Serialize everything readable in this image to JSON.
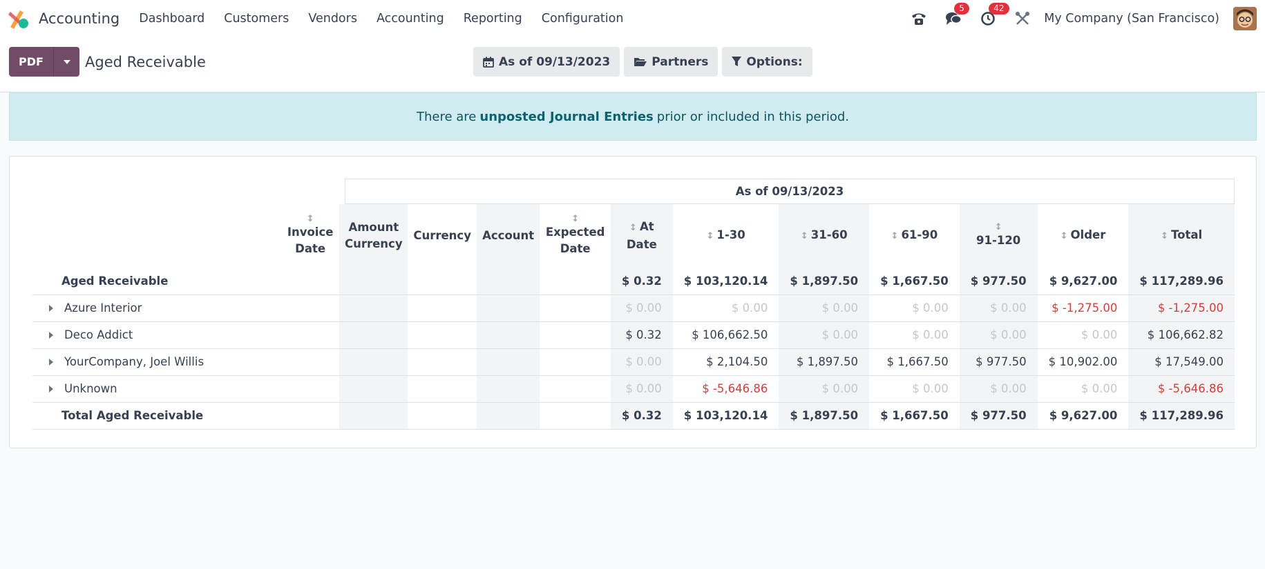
{
  "nav": {
    "app_name": "Accounting",
    "menu": [
      "Dashboard",
      "Customers",
      "Vendors",
      "Accounting",
      "Reporting",
      "Configuration"
    ],
    "messages_count": "5",
    "activities_count": "42",
    "company": "My Company (San Francisco)"
  },
  "control": {
    "pdf_label": "PDF",
    "title": "Aged Receivable",
    "date_filter": "As of 09/13/2023",
    "partners_filter": "Partners",
    "options_filter": "Options:"
  },
  "alert": {
    "prefix": "There are",
    "link": "unposted Journal Entries",
    "suffix": "prior or included in this period."
  },
  "report": {
    "period": "As of 09/13/2023",
    "columns": [
      "Invoice Date",
      "Amount Currency",
      "Currency",
      "Account",
      "Expected Date",
      "At Date",
      "1-30",
      "31-60",
      "61-90",
      "91-120",
      "Older",
      "Total"
    ],
    "group_label": "Aged Receivable",
    "group_values": [
      "$ 0.32",
      "$ 103,120.14",
      "$ 1,897.50",
      "$ 1,667.50",
      "$ 977.50",
      "$ 9,627.00",
      "$ 117,289.96"
    ],
    "rows": [
      {
        "name": "Azure Interior",
        "values": [
          "$ 0.00",
          "$ 0.00",
          "$ 0.00",
          "$ 0.00",
          "$ 0.00",
          "$ -1,275.00",
          "$ -1,275.00"
        ]
      },
      {
        "name": "Deco Addict",
        "values": [
          "$ 0.32",
          "$ 106,662.50",
          "$ 0.00",
          "$ 0.00",
          "$ 0.00",
          "$ 0.00",
          "$ 106,662.82"
        ]
      },
      {
        "name": "YourCompany, Joel Willis",
        "values": [
          "$ 0.00",
          "$ 2,104.50",
          "$ 1,897.50",
          "$ 1,667.50",
          "$ 977.50",
          "$ 10,902.00",
          "$ 17,549.00"
        ]
      },
      {
        "name": "Unknown",
        "values": [
          "$ 0.00",
          "$ -5,646.86",
          "$ 0.00",
          "$ 0.00",
          "$ 0.00",
          "$ 0.00",
          "$ -5,646.86"
        ]
      }
    ],
    "total_label": "Total Aged Receivable",
    "total_values": [
      "$ 0.32",
      "$ 103,120.14",
      "$ 1,897.50",
      "$ 1,667.50",
      "$ 977.50",
      "$ 9,627.00",
      "$ 117,289.96"
    ]
  }
}
